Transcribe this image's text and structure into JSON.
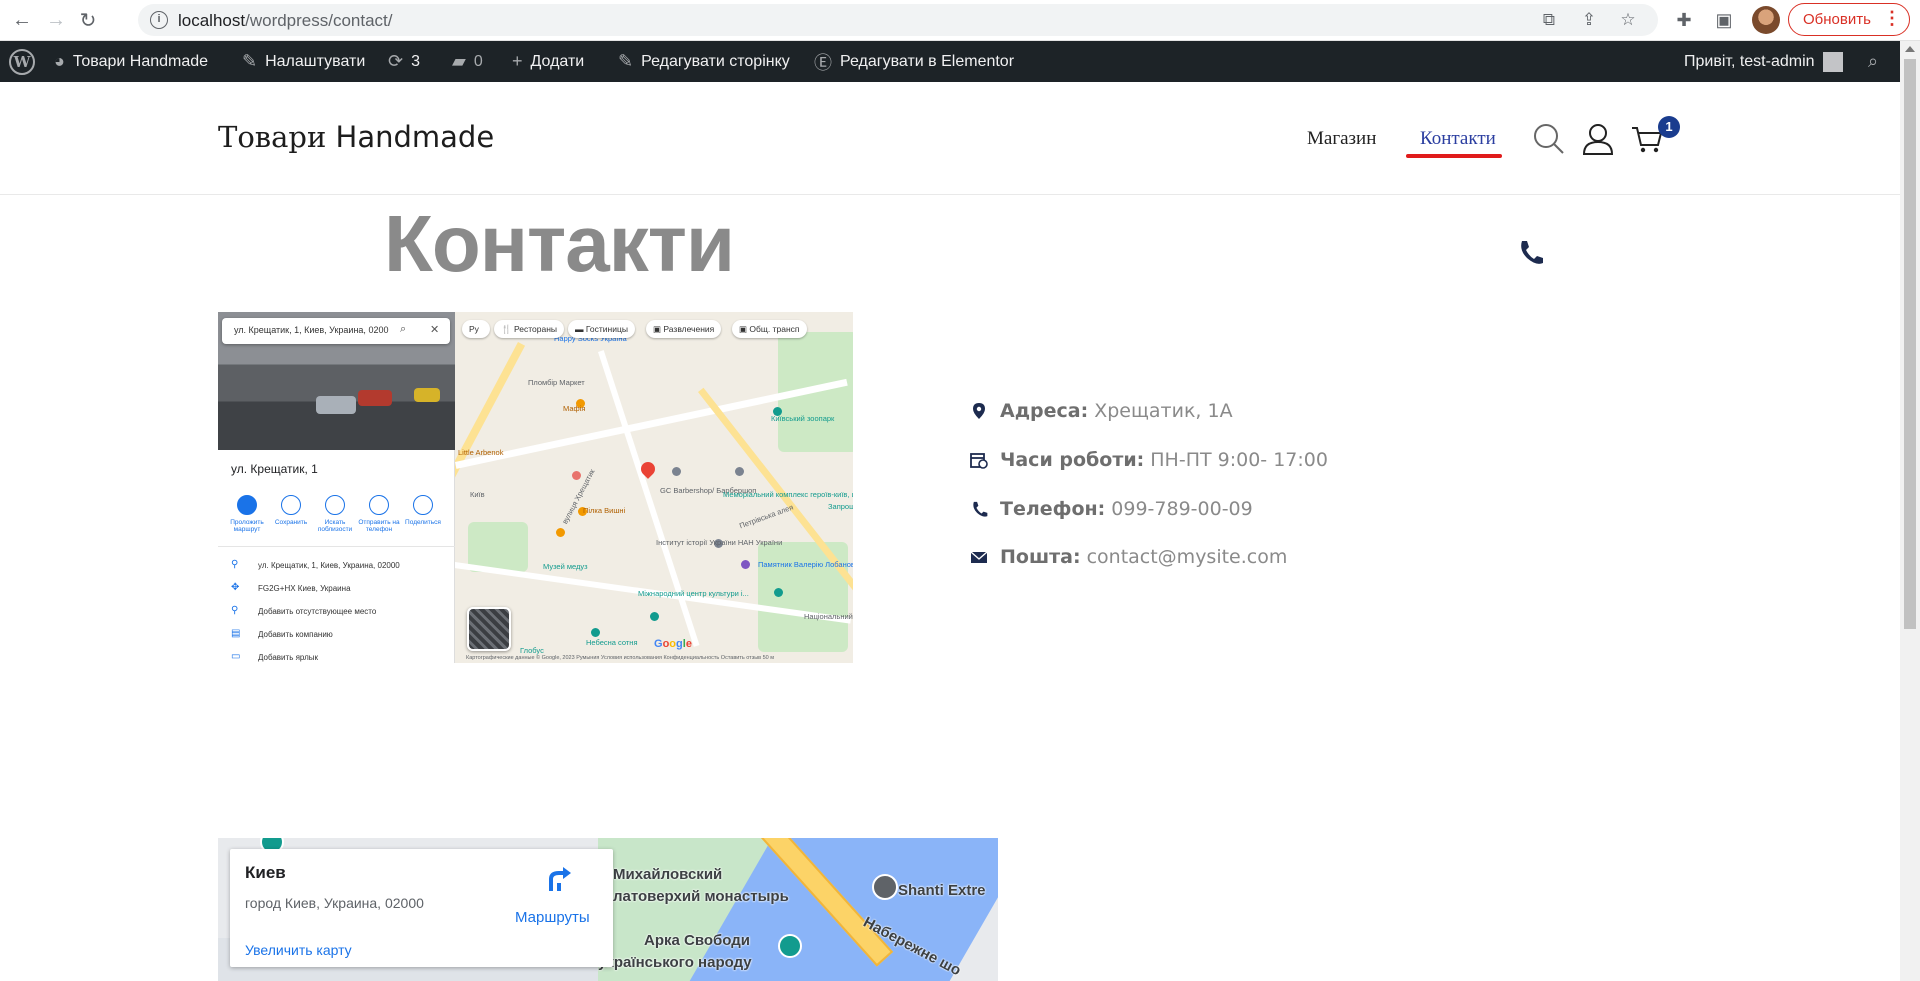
{
  "browser": {
    "url_host": "localhost",
    "url_path": "/wordpress/contact/",
    "update_label": "Обновить"
  },
  "adminbar": {
    "site_name": "Товари Handmade",
    "customize": "Налаштувати",
    "updates_count": "3",
    "comments_count": "0",
    "add_new": "Додати",
    "edit_page": "Редагувати сторінку",
    "edit_elementor": "Редагувати в Elementor",
    "greeting": "Привіт, test-admin"
  },
  "header": {
    "site_title_ua": "Товари",
    "site_title_en": "Handmade",
    "menu": [
      "Магазин",
      "Контакти"
    ],
    "cart_count": "1"
  },
  "page": {
    "title": "Контакти"
  },
  "map_screenshot": {
    "search_value": "ул. Крещатик, 1, Киев, Украина, 0200",
    "place_name": "ул. Крещатик, 1",
    "actions": [
      "Проложить маршрут",
      "Сохранить",
      "Искать поблизости",
      "Отправить на телефон",
      "Поделиться"
    ],
    "info_rows": [
      "ул. Крещатик, 1, Киев, Украина, 02000",
      "FG2G+HX Киев, Украина",
      "Добавить отсутствующее место",
      "Добавить компанию",
      "Добавить ярлык"
    ],
    "chips": [
      "Ру",
      "Рестораны",
      "Гостиницы",
      "Развлечения",
      "Общ. трансп"
    ],
    "labels": [
      "Happy Socks Україна",
      "Пломбір Маркет",
      "Мафія",
      "Little Arbenok",
      "вулиця Хрещатик",
      "GC Barbershop/ Барбершоп",
      "Пілка Вишні",
      "Інститут історії України НАН України",
      "Меморіальний комплекс героїв-київ, що",
      "Музей медуз",
      "Міжнародний центр культури і...",
      "Небесна сотня",
      "Глобус",
      "Київський зоопарк",
      "Памятник Валерію Лобановському",
      "Національний музей Києва",
      "Петрівська алея",
      "Київ",
      "Запрошуємо на електри"
    ],
    "footer": "Картографические данные © Google, 2023   Румыния   Условия использования   Конфиденциальность   Оставить отзыв   50 м"
  },
  "contact": {
    "address_label": "Адреса:",
    "address_value": "Хрещатик, 1А",
    "hours_label": "Часи роботи:",
    "hours_value": "ПН-ПТ 9:00- 17:00",
    "phone_label": "Телефон:",
    "phone_value": "099-789-00-09",
    "email_label": "Пошта:",
    "email_value": "contact@mysite.com"
  },
  "map_embed": {
    "city": "Киев",
    "address": "город Киев, Украина, 02000",
    "enlarge": "Увеличить карту",
    "routes": "Маршруты",
    "labels": [
      "Михайловский",
      "латоверхий монастырь",
      "Арка Свободи",
      "українського народу",
      "Shanti Extre",
      "Набережне шо"
    ]
  },
  "colors": {
    "admin_bar": "#1d2327",
    "accent_blue": "#2b3ea0",
    "underline_red": "#e01b1b",
    "cart_badge": "#1a3c8e",
    "update_red": "#d93025"
  }
}
